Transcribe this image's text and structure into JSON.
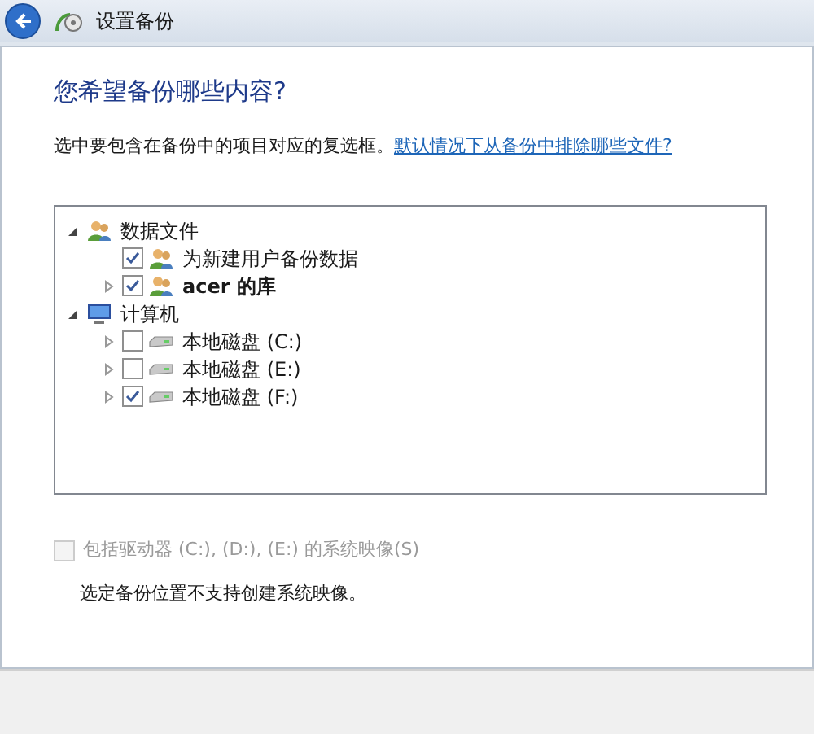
{
  "window": {
    "title": "设置备份"
  },
  "heading": "您希望备份哪些内容?",
  "instruction": {
    "text": "选中要包含在备份中的项目对应的复选框。",
    "link": "默认情况下从备份中排除哪些文件?"
  },
  "tree": [
    {
      "kind": "users",
      "label": "数据文件",
      "expanded": true,
      "children": [
        {
          "kind": "users",
          "label": "为新建用户备份数据",
          "checked": true
        },
        {
          "kind": "users",
          "label": "acer 的库",
          "bold": true,
          "checked": true,
          "expanded": false
        }
      ]
    },
    {
      "kind": "computer",
      "label": "计算机",
      "expanded": true,
      "children": [
        {
          "kind": "drive",
          "label": "本地磁盘 (C:)",
          "checked": false,
          "expanded": false
        },
        {
          "kind": "drive",
          "label": "本地磁盘 (E:)",
          "checked": false,
          "expanded": false
        },
        {
          "kind": "drive",
          "label": "本地磁盘 (F:)",
          "checked": true,
          "expanded": false
        }
      ]
    }
  ],
  "system_image": {
    "label": "包括驱动器 (C:), (D:), (E:) 的系统映像(S)",
    "checked": false,
    "disabled": true
  },
  "note": "选定备份位置不支持创建系统映像。"
}
